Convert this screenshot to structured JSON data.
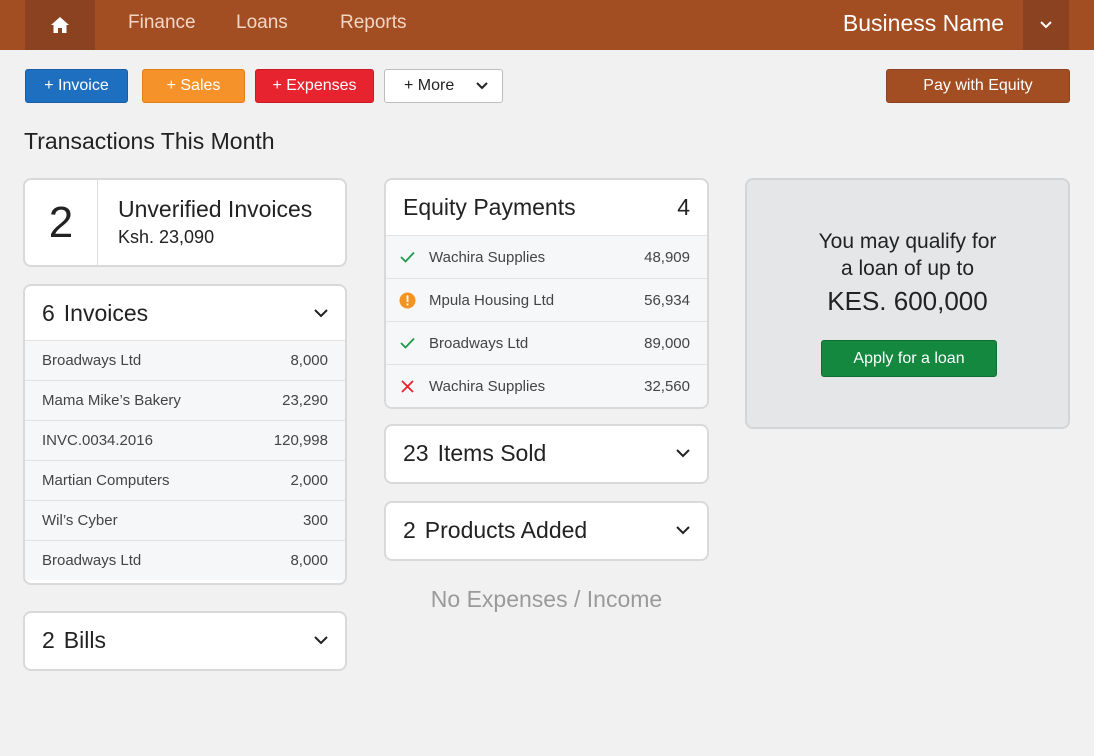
{
  "nav": {
    "links": [
      "Finance",
      "Loans",
      "Reports"
    ],
    "business_name": "Business Name",
    "home_icon": "home-icon",
    "menu_icon": "chevron-down-icon"
  },
  "actions": {
    "invoice": "+ Invoice",
    "sales": "+ Sales",
    "expenses": "+ Expenses",
    "more": "+ More",
    "pay_equity": "Pay with Equity"
  },
  "section_title": "Transactions This Month",
  "unverified": {
    "count": "2",
    "label": "Unverified Invoices",
    "amount": "Ksh. 23,090"
  },
  "invoices": {
    "count": "6",
    "label": "Invoices",
    "rows": [
      {
        "name": "Broadways Ltd",
        "amount": "8,000"
      },
      {
        "name": "Mama Mike’s Bakery",
        "amount": "23,290"
      },
      {
        "name": "INVC.0034.2016",
        "amount": "120,998"
      },
      {
        "name": "Martian Computers",
        "amount": "2,000"
      },
      {
        "name": "Wil’s Cyber",
        "amount": "300"
      },
      {
        "name": "Broadways Ltd",
        "amount": "8,000"
      }
    ]
  },
  "bills": {
    "count": "2",
    "label": "Bills"
  },
  "equity_payments": {
    "label": "Equity Payments",
    "count": "4",
    "rows": [
      {
        "status": "check-icon",
        "name": "Wachira Supplies",
        "amount": "48,909"
      },
      {
        "status": "warning-icon",
        "name": "Mpula Housing Ltd",
        "amount": "56,934"
      },
      {
        "status": "check-icon",
        "name": "Broadways Ltd",
        "amount": "89,000"
      },
      {
        "status": "cross-icon",
        "name": "Wachira Supplies",
        "amount": "32,560"
      }
    ]
  },
  "items_sold": {
    "count": "23",
    "label": "Items Sold"
  },
  "products_added": {
    "count": "2",
    "label": "Products Added"
  },
  "no_expenses": "No Expenses / Income",
  "loan": {
    "line1": "You may qualify for",
    "line2": "a loan of up to",
    "amount": "KES. 600,000",
    "apply": "Apply for a loan"
  },
  "colors": {
    "brand": "#a34e22",
    "invoice": "#1f6fc1",
    "sales": "#f5932a",
    "expenses": "#e7232f",
    "apply": "#14883e"
  }
}
